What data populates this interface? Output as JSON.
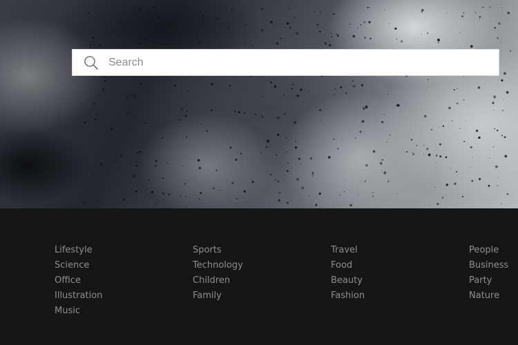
{
  "search": {
    "placeholder": "Search",
    "value": ""
  },
  "categories": {
    "column_1": [
      "Lifestyle",
      "Science",
      "Office",
      "Illustration",
      "Music"
    ],
    "column_2": [
      "Sports",
      "Technology",
      "Children",
      "Family"
    ],
    "column_3": [
      "Travel",
      "Food",
      "Beauty",
      "Fashion"
    ],
    "column_4": [
      "People",
      "Business",
      "Party",
      "Nature"
    ]
  },
  "colors": {
    "footer_background": "#151515",
    "category_text": "#8f8f8f",
    "search_background": "#ffffff",
    "placeholder_text": "#8e8e8e"
  },
  "icons": {
    "search": "search-icon"
  }
}
